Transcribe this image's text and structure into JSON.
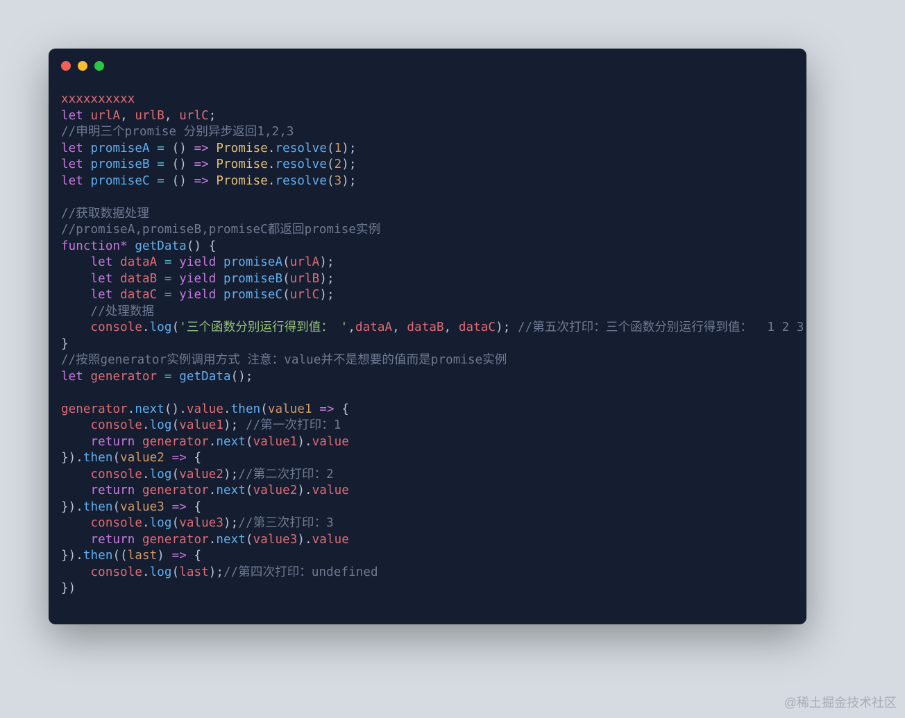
{
  "colors": {
    "red": "#f25f57",
    "yellow": "#fabd2f",
    "green": "#28c940"
  },
  "watermark": "@稀土掘金技术社区",
  "code": {
    "l1": {
      "s1": "xxxxxxxxxx"
    },
    "l2": {
      "s1": "let ",
      "s2": "urlA",
      "s3": ", ",
      "s4": "urlB",
      "s5": ", ",
      "s6": "urlC",
      "s7": ";"
    },
    "l3": {
      "s1": "//申明三个promise 分别异步返回1,2,3"
    },
    "l4": {
      "s1": "let ",
      "s2": "promiseA ",
      "s3": "= ",
      "s4": "() ",
      "s5": "=> ",
      "s6": "Promise",
      "s7": ".",
      "s8": "resolve",
      "s9": "(",
      "s10": "1",
      "s11": ");"
    },
    "l5": {
      "s1": "let ",
      "s2": "promiseB ",
      "s3": "= ",
      "s4": "() ",
      "s5": "=> ",
      "s6": "Promise",
      "s7": ".",
      "s8": "resolve",
      "s9": "(",
      "s10": "2",
      "s11": ");"
    },
    "l6": {
      "s1": "let ",
      "s2": "promiseC ",
      "s3": "= ",
      "s4": "() ",
      "s5": "=> ",
      "s6": "Promise",
      "s7": ".",
      "s8": "resolve",
      "s9": "(",
      "s10": "3",
      "s11": ");"
    },
    "l7": {
      "s1": ""
    },
    "l8": {
      "s1": "//获取数据处理"
    },
    "l9": {
      "s1": "//promiseA,promiseB,promiseC都返回promise实例"
    },
    "l10": {
      "s1": "function* ",
      "s2": "getData",
      "s3": "() {"
    },
    "l11": {
      "s1": "    ",
      "s2": "let ",
      "s3": "dataA ",
      "s4": "= ",
      "s5": "yield ",
      "s6": "promiseA",
      "s7": "(",
      "s8": "urlA",
      "s9": ");"
    },
    "l12": {
      "s1": "    ",
      "s2": "let ",
      "s3": "dataB ",
      "s4": "= ",
      "s5": "yield ",
      "s6": "promiseB",
      "s7": "(",
      "s8": "urlB",
      "s9": ");"
    },
    "l13": {
      "s1": "    ",
      "s2": "let ",
      "s3": "dataC ",
      "s4": "= ",
      "s5": "yield ",
      "s6": "promiseC",
      "s7": "(",
      "s8": "urlC",
      "s9": ");"
    },
    "l14": {
      "s1": "    ",
      "s2": "//处理数据"
    },
    "l15": {
      "s1": "    ",
      "s2": "console",
      "s3": ".",
      "s4": "log",
      "s5": "(",
      "s6": "'三个函数分别运行得到值： '",
      "s7": ",",
      "s8": "dataA",
      "s9": ", ",
      "s10": "dataB",
      "s11": ", ",
      "s12": "dataC",
      "s13": "); ",
      "s14": "//第五次打印：三个函数分别运行得到值：  1 2 3"
    },
    "l16": {
      "s1": "}"
    },
    "l17": {
      "s1": "//按照generator实例调用方式 注意：value并不是想要的值而是promise实例"
    },
    "l18": {
      "s1": "let ",
      "s2": "generator ",
      "s3": "= ",
      "s4": "getData",
      "s5": "();"
    },
    "l19": {
      "s1": ""
    },
    "l20": {
      "s1": "generator",
      "s2": ".",
      "s3": "next",
      "s4": "().",
      "s5": "value",
      "s6": ".",
      "s7": "then",
      "s8": "(",
      "s9": "value1 ",
      "s10": "=> ",
      "s11": "{"
    },
    "l21": {
      "s1": "    ",
      "s2": "console",
      "s3": ".",
      "s4": "log",
      "s5": "(",
      "s6": "value1",
      "s7": "); ",
      "s8": "//第一次打印：1"
    },
    "l22": {
      "s1": "    ",
      "s2": "return ",
      "s3": "generator",
      "s4": ".",
      "s5": "next",
      "s6": "(",
      "s7": "value1",
      "s8": ").",
      "s9": "value"
    },
    "l23": {
      "s1": "}).",
      "s2": "then",
      "s3": "(",
      "s4": "value2 ",
      "s5": "=> ",
      "s6": "{"
    },
    "l24": {
      "s1": "    ",
      "s2": "console",
      "s3": ".",
      "s4": "log",
      "s5": "(",
      "s6": "value2",
      "s7": ");",
      "s8": "//第二次打印：2"
    },
    "l25": {
      "s1": "    ",
      "s2": "return ",
      "s3": "generator",
      "s4": ".",
      "s5": "next",
      "s6": "(",
      "s7": "value2",
      "s8": ").",
      "s9": "value"
    },
    "l26": {
      "s1": "}).",
      "s2": "then",
      "s3": "(",
      "s4": "value3 ",
      "s5": "=> ",
      "s6": "{"
    },
    "l27": {
      "s1": "    ",
      "s2": "console",
      "s3": ".",
      "s4": "log",
      "s5": "(",
      "s6": "value3",
      "s7": ");",
      "s8": "//第三次打印：3"
    },
    "l28": {
      "s1": "    ",
      "s2": "return ",
      "s3": "generator",
      "s4": ".",
      "s5": "next",
      "s6": "(",
      "s7": "value3",
      "s8": ").",
      "s9": "value"
    },
    "l29": {
      "s1": "}).",
      "s2": "then",
      "s3": "((",
      "s4": "last",
      "s5": ") ",
      "s6": "=> ",
      "s7": "{"
    },
    "l30": {
      "s1": "    ",
      "s2": "console",
      "s3": ".",
      "s4": "log",
      "s5": "(",
      "s6": "last",
      "s7": ");",
      "s8": "//第四次打印：undefined"
    },
    "l31": {
      "s1": "})"
    }
  }
}
